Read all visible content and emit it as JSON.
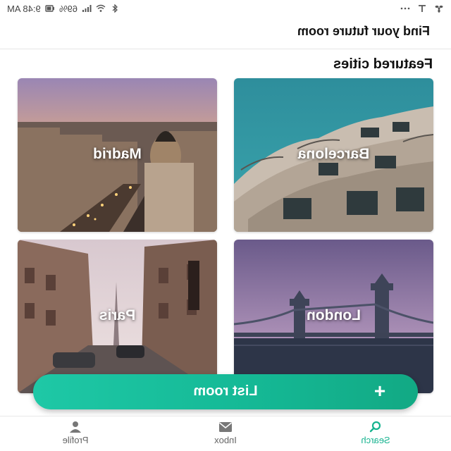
{
  "status_bar": {
    "time": "9:48 AM",
    "battery": "69%",
    "icons": [
      "more-icon",
      "t-icon",
      "fan-icon",
      "bluetooth-icon",
      "wifi-icon",
      "signal-icon",
      "battery-icon"
    ]
  },
  "header": {
    "title": "Find your future room"
  },
  "featured": {
    "title": "Featured cities",
    "cities": [
      {
        "name": "Barcelona"
      },
      {
        "name": "Madrid"
      },
      {
        "name": "London"
      },
      {
        "name": "Paris"
      }
    ]
  },
  "fab": {
    "label": "List room",
    "icon": "plus-icon"
  },
  "bottom_nav": {
    "items": [
      {
        "label": "Search",
        "icon": "search-icon",
        "active": true
      },
      {
        "label": "Inbox",
        "icon": "mail-icon",
        "active": false
      },
      {
        "label": "Profile",
        "icon": "person-icon",
        "active": false
      }
    ]
  },
  "colors": {
    "accent": "#16b38f",
    "fab_start": "#1ec8a6",
    "fab_end": "#12a984"
  }
}
